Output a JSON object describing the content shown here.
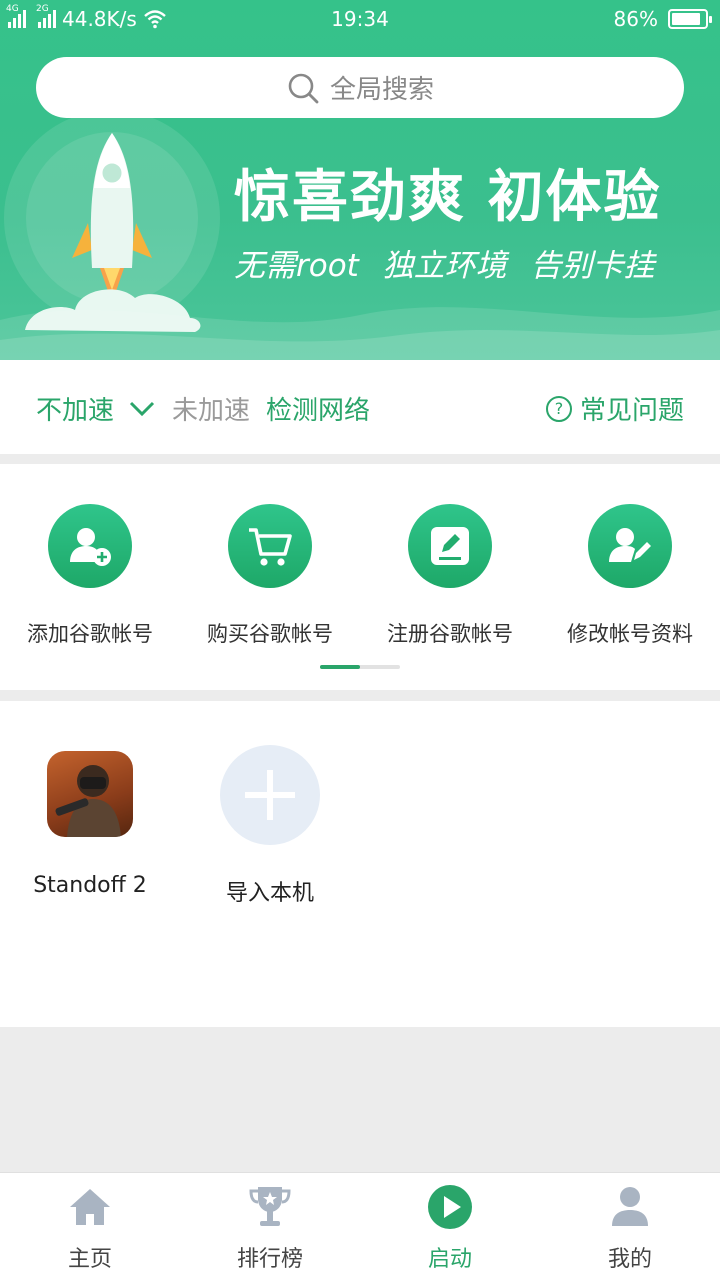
{
  "status_bar": {
    "left_net1": "4G",
    "left_net2": "2G",
    "speed": "44.8K/s",
    "time": "19:34",
    "battery": "86%",
    "battery_level": 0.86
  },
  "search": {
    "placeholder": "全局搜索"
  },
  "banner": {
    "headline": "惊喜劲爽  初体验",
    "subline": "无需root 独立环境 告别卡挂"
  },
  "accel": {
    "mode": "不加速",
    "state": "未加速",
    "detect": "检测网络",
    "faq": "常见问题"
  },
  "actions": [
    {
      "label": "添加谷歌帐号",
      "icon": "add-user-icon"
    },
    {
      "label": "购买谷歌帐号",
      "icon": "cart-icon"
    },
    {
      "label": "注册谷歌帐号",
      "icon": "edit-note-icon"
    },
    {
      "label": "修改帐号资料",
      "icon": "user-edit-icon"
    }
  ],
  "apps": [
    {
      "label": "Standoff 2",
      "icon": "standoff2-app-icon"
    },
    {
      "label": "导入本机",
      "icon": "plus-icon"
    }
  ],
  "bottom_nav": [
    {
      "label": "主页",
      "icon": "home-icon",
      "active": false
    },
    {
      "label": "排行榜",
      "icon": "trophy-icon",
      "active": false
    },
    {
      "label": "启动",
      "icon": "play-icon",
      "active": true
    },
    {
      "label": "我的",
      "icon": "user-icon",
      "active": false
    }
  ],
  "colors": {
    "brand_green": "#2aa56a",
    "hero_green": "#35c28a",
    "inactive_icon": "#a9b4c2"
  }
}
